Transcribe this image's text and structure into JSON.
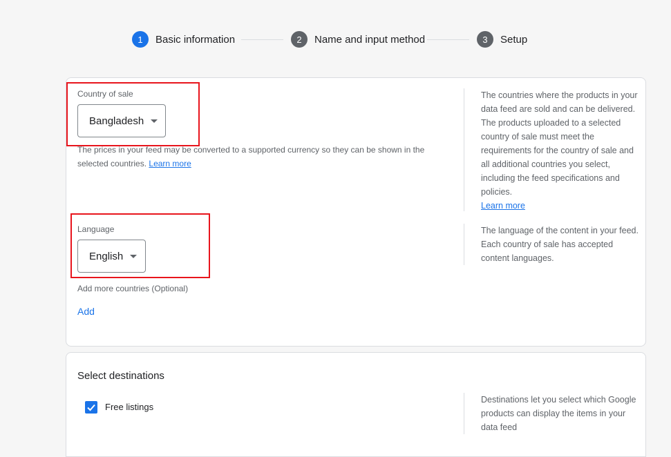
{
  "stepper": {
    "steps": [
      {
        "number": "1",
        "label": "Basic information",
        "active": true
      },
      {
        "number": "2",
        "label": "Name and input method",
        "active": false
      },
      {
        "number": "3",
        "label": "Setup",
        "active": false
      }
    ]
  },
  "basic_info": {
    "country": {
      "label": "Country of sale",
      "value": "Bangladesh",
      "help_text": "The prices in your feed may be converted to a supported currency so they can be shown in the selected countries.",
      "help_link": "Learn more",
      "side_note": "The countries where the products in your data feed are sold and can be delivered. The products uploaded to a selected country of sale must meet the requirements for the country of sale and all additional countries you select, including the feed specifications and policies.",
      "side_link": "Learn more"
    },
    "language": {
      "label": "Language",
      "value": "English",
      "side_note": "The language of the content in your feed. Each country of sale has accepted content languages."
    },
    "add_more": {
      "label": "Add more countries (Optional)",
      "button": "Add"
    }
  },
  "destinations": {
    "title": "Select destinations",
    "free_listings_label": "Free listings",
    "free_listings_checked": true,
    "side_note": "Destinations let you select which Google products can display the items in your data feed"
  },
  "colors": {
    "accent": "#1a73e8",
    "highlight": "#e8141c"
  }
}
